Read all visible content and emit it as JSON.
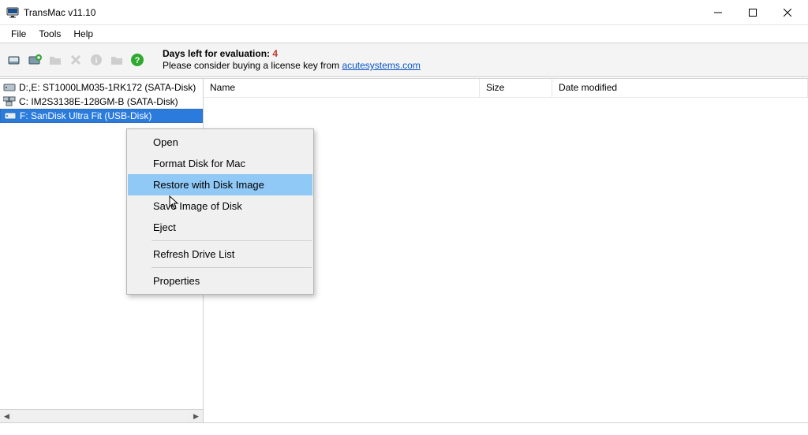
{
  "titlebar": {
    "title": "TransMac v11.10"
  },
  "menubar": {
    "file": "File",
    "tools": "Tools",
    "help": "Help"
  },
  "eval": {
    "line1_prefix": "Days left for evaluation: ",
    "days": "4",
    "line2_prefix": "Please consider buying a license key from ",
    "link_text": "acutesystems.com"
  },
  "columns": {
    "name": "Name",
    "size": "Size",
    "date": "Date modified"
  },
  "drives": [
    {
      "label": "D:,E:  ST1000LM035-1RK172 (SATA-Disk)",
      "selected": false
    },
    {
      "label": "C:  IM2S3138E-128GM-B (SATA-Disk)",
      "selected": false
    },
    {
      "label": "F: SanDisk Ultra Fit (USB-Disk)",
      "selected": true
    }
  ],
  "context_menu": {
    "open": "Open",
    "format": "Format Disk for Mac",
    "restore": "Restore with Disk Image",
    "save_image": "Save Image of Disk",
    "eject": "Eject",
    "refresh": "Refresh Drive List",
    "properties": "Properties"
  }
}
